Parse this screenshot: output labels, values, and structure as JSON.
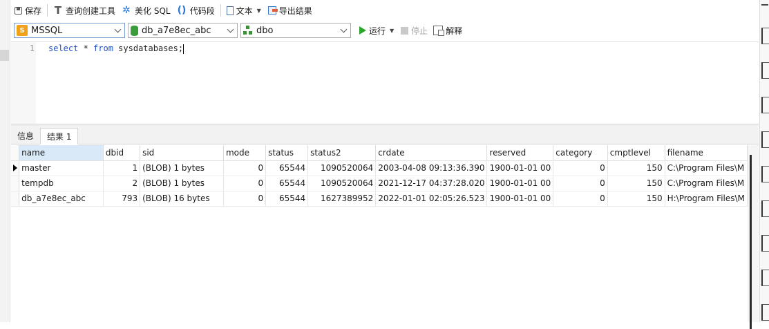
{
  "toolbar": {
    "save": "保存",
    "query_builder": "查询创建工具",
    "beautify": "美化 SQL",
    "code_snippet": "代码段",
    "text": "文本",
    "export": "导出结果"
  },
  "connection": {
    "dbms": "MSSQL",
    "database": "db_a7e8ec_abc",
    "schema": "dbo",
    "run": "运行",
    "stop": "停止",
    "explain": "解释"
  },
  "editor": {
    "line_number": "1",
    "keyword1": "select",
    "middle": " * ",
    "keyword2": "from",
    "rest": " sysdatabases;"
  },
  "tabs": [
    {
      "label": "信息"
    },
    {
      "label": "结果 1"
    }
  ],
  "grid": {
    "columns": [
      "name",
      "dbid",
      "sid",
      "mode",
      "status",
      "status2",
      "crdate",
      "reserved",
      "category",
      "cmptlevel",
      "filename"
    ],
    "rows": [
      [
        "master",
        "1",
        "(BLOB) 1 bytes",
        "0",
        "65544",
        "1090520064",
        "2003-04-08 09:13:36.390",
        "1900-01-01 00",
        "0",
        "150",
        "C:\\Program Files\\M"
      ],
      [
        "tempdb",
        "2",
        "(BLOB) 1 bytes",
        "0",
        "65544",
        "1090520064",
        "2021-12-17 04:37:28.020",
        "1900-01-01 00",
        "0",
        "150",
        "C:\\Program Files\\M"
      ],
      [
        "db_a7e8ec_abc",
        "793",
        "(BLOB) 16 bytes",
        "0",
        "65544",
        "1627389952",
        "2022-01-01 02:05:26.523",
        "1900-01-01 00",
        "0",
        "150",
        "H:\\Program Files\\M"
      ]
    ]
  },
  "colors": {
    "keyword": "#1f4fc4",
    "run_green": "#2aa52a",
    "selected_header": "#d9e9f8"
  }
}
